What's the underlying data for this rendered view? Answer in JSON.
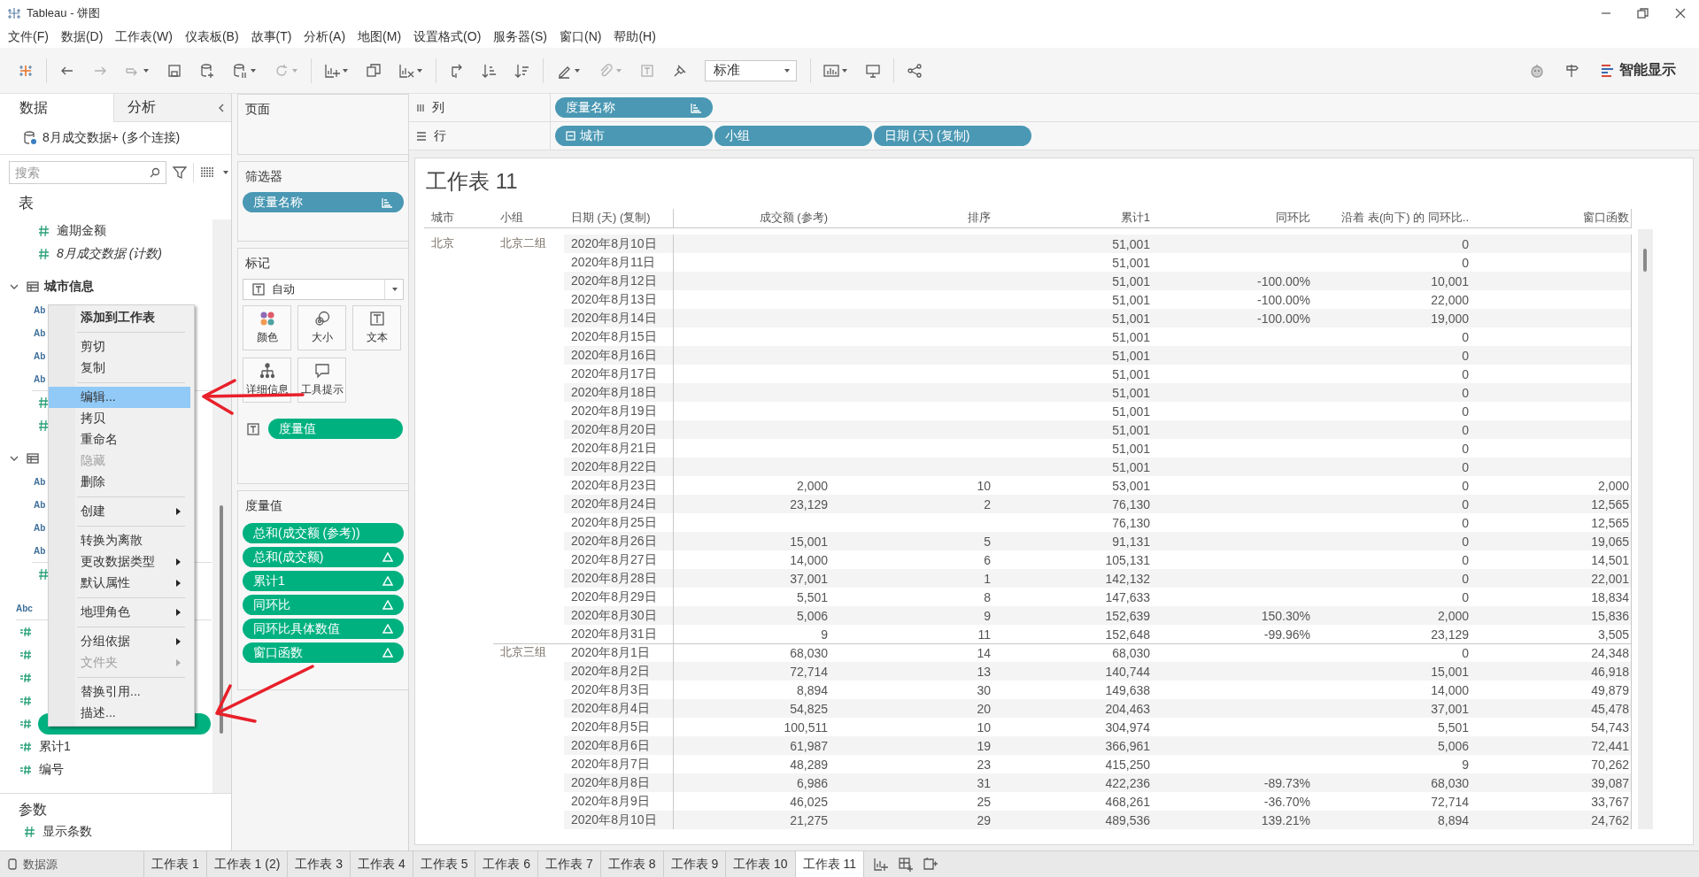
{
  "window": {
    "title": "Tableau - 饼图"
  },
  "menu_bar": [
    "文件(F)",
    "数据(D)",
    "工作表(W)",
    "仪表板(B)",
    "故事(T)",
    "分析(A)",
    "地图(M)",
    "设置格式(O)",
    "服务器(S)",
    "窗口(N)",
    "帮助(H)"
  ],
  "toolbar": {
    "fit_dropdown": "标准",
    "show_me": "智能显示"
  },
  "data_pane": {
    "tabs": [
      {
        "label": "数据",
        "selected": true
      },
      {
        "label": "分析",
        "selected": false
      }
    ],
    "data_source": "8月成交数据+ (多个连接)",
    "search": {
      "placeholder": "搜索"
    },
    "section_title": "表",
    "tables": [
      {
        "items": [
          {
            "kind": "measure",
            "name": "逾期金额",
            "selected": false
          },
          {
            "kind": "measure",
            "name": "8月成交数据 (计数)",
            "italic": true,
            "selected": false
          }
        ]
      },
      {
        "name": "城市信息",
        "expanded": true,
        "items": [
          {
            "kind": "dimension",
            "icon_text": "Ab",
            "selected": false
          },
          {
            "kind": "dimension",
            "icon_text": "Ab",
            "selected": false
          },
          {
            "kind": "dimension",
            "icon_text": "Ab",
            "selected": false
          },
          {
            "kind": "dimension",
            "icon_text": "Ab",
            "selected": false
          },
          {
            "kind": "divider"
          },
          {
            "kind": "measure",
            "selected": false
          },
          {
            "kind": "measure",
            "selected": false
          }
        ]
      },
      {
        "expanded": true,
        "items": [
          {
            "kind": "dimension",
            "icon_text": "Ab",
            "selected": false
          },
          {
            "kind": "dimension",
            "icon_text": "Ab",
            "selected": false
          },
          {
            "kind": "dimension",
            "icon_text": "Ab",
            "selected": false
          },
          {
            "kind": "dimension",
            "icon_text": "Ab",
            "selected": false
          },
          {
            "kind": "divider"
          },
          {
            "kind": "measure",
            "selected": false
          }
        ]
      }
    ],
    "loose_fields": [
      {
        "kind": "dimension",
        "icon_text": "Abc",
        "selected": false
      },
      {
        "kind": "divider"
      },
      {
        "kind": "calc",
        "selected": false
      },
      {
        "kind": "calc",
        "selected": false
      },
      {
        "kind": "calc",
        "selected": false
      },
      {
        "kind": "calc",
        "selected": false
      },
      {
        "kind": "calc",
        "selected": true
      },
      {
        "kind": "calc",
        "name": "累计1",
        "selected": false
      },
      {
        "kind": "calc",
        "name": "编号",
        "selected": false
      }
    ],
    "parameters_title": "参数",
    "parameters": [
      {
        "kind": "measure",
        "name": "显示条数"
      }
    ]
  },
  "context_menu": [
    {
      "kind": "item",
      "label": "添加到工作表",
      "bold": true,
      "selected": false
    },
    {
      "kind": "separator"
    },
    {
      "kind": "item",
      "label": "剪切",
      "selected": false
    },
    {
      "kind": "item",
      "label": "复制",
      "selected": false
    },
    {
      "kind": "separator"
    },
    {
      "kind": "item",
      "label": "编辑...",
      "selected": true
    },
    {
      "kind": "item",
      "label": "拷贝",
      "selected": false
    },
    {
      "kind": "item",
      "label": "重命名",
      "selected": false
    },
    {
      "kind": "item",
      "label": "隐藏",
      "disabled": true,
      "selected": false
    },
    {
      "kind": "item",
      "label": "删除",
      "selected": false
    },
    {
      "kind": "separator"
    },
    {
      "kind": "item",
      "label": "创建",
      "submenu": true,
      "selected": false
    },
    {
      "kind": "separator"
    },
    {
      "kind": "item",
      "label": "转换为离散",
      "selected": false
    },
    {
      "kind": "item",
      "label": "更改数据类型",
      "submenu": true,
      "selected": false
    },
    {
      "kind": "item",
      "label": "默认属性",
      "submenu": true,
      "selected": false
    },
    {
      "kind": "separator"
    },
    {
      "kind": "item",
      "label": "地理角色",
      "submenu": true,
      "selected": false
    },
    {
      "kind": "separator"
    },
    {
      "kind": "item",
      "label": "分组依据",
      "submenu": true,
      "selected": false
    },
    {
      "kind": "item",
      "label": "文件夹",
      "submenu": true,
      "disabled": true,
      "selected": false
    },
    {
      "kind": "separator"
    },
    {
      "kind": "item",
      "label": "替换引用...",
      "selected": false
    },
    {
      "kind": "item",
      "label": "描述...",
      "selected": false
    }
  ],
  "cards": {
    "pages": {
      "title": "页面"
    },
    "filters": {
      "title": "筛选器",
      "pills": [
        {
          "label": "度量名称",
          "kind": "dimension",
          "sorted": true
        }
      ]
    },
    "marks": {
      "title": "标记",
      "mark_type": "自动",
      "buttons": [
        {
          "label": "颜色",
          "kind": "color"
        },
        {
          "label": "大小",
          "kind": "size"
        },
        {
          "label": "文本",
          "kind": "text"
        },
        {
          "label": "详细信息",
          "kind": "detail"
        },
        {
          "label": "工具提示",
          "kind": "tooltip"
        }
      ],
      "encodings": [
        {
          "kind": "text",
          "pill": {
            "label": "度量值",
            "kind": "measure"
          }
        }
      ]
    },
    "measure_values": {
      "title": "度量值",
      "pills": [
        {
          "label": "总和(成交额 (参考))",
          "kind": "measure",
          "table_calc": false
        },
        {
          "label": "总和(成交额)",
          "kind": "measure",
          "table_calc": true
        },
        {
          "label": "累计1",
          "kind": "measure",
          "table_calc": true
        },
        {
          "label": "同环比",
          "kind": "measure",
          "table_calc": true
        },
        {
          "label": "同环比具体数值",
          "kind": "measure",
          "table_calc": true
        },
        {
          "label": "窗口函数",
          "kind": "measure",
          "table_calc": true
        }
      ]
    }
  },
  "shelves": {
    "columns": {
      "label": "列",
      "pills": [
        {
          "label": "度量名称",
          "kind": "dimension",
          "sorted": true
        }
      ]
    },
    "rows": {
      "label": "行",
      "pills": [
        {
          "label": "城市",
          "kind": "dimension",
          "expandable": true
        },
        {
          "label": "小组",
          "kind": "dimension"
        },
        {
          "label": "日期 (天) (复制)",
          "kind": "dimension"
        }
      ]
    }
  },
  "view": {
    "title": "工作表 11",
    "columns": [
      "城市",
      "小组",
      "日期 (天) (复制)",
      "成交额 (参考)",
      "排序",
      "累计1",
      "同环比",
      "沿着 表(向下) 的 同环比..",
      "窗口函数"
    ],
    "groups": [
      {
        "city": "北京",
        "name": "北京二组",
        "rows": [
          {
            "date": "2020年8月10日",
            "cum": "51,001",
            "along": "0"
          },
          {
            "date": "2020年8月11日",
            "cum": "51,001",
            "along": "0"
          },
          {
            "date": "2020年8月12日",
            "cum": "51,001",
            "yoy": "-100.00%",
            "along": "10,001"
          },
          {
            "date": "2020年8月13日",
            "cum": "51,001",
            "yoy": "-100.00%",
            "along": "22,000"
          },
          {
            "date": "2020年8月14日",
            "cum": "51,001",
            "yoy": "-100.00%",
            "along": "19,000"
          },
          {
            "date": "2020年8月15日",
            "cum": "51,001",
            "along": "0"
          },
          {
            "date": "2020年8月16日",
            "cum": "51,001",
            "along": "0"
          },
          {
            "date": "2020年8月17日",
            "cum": "51,001",
            "along": "0"
          },
          {
            "date": "2020年8月18日",
            "cum": "51,001",
            "along": "0"
          },
          {
            "date": "2020年8月19日",
            "cum": "51,001",
            "along": "0"
          },
          {
            "date": "2020年8月20日",
            "cum": "51,001",
            "along": "0"
          },
          {
            "date": "2020年8月21日",
            "cum": "51,001",
            "along": "0"
          },
          {
            "date": "2020年8月22日",
            "cum": "51,001",
            "along": "0"
          },
          {
            "date": "2020年8月23日",
            "amount": "2,000",
            "rank": "10",
            "cum": "53,001",
            "along": "0",
            "window": "2,000"
          },
          {
            "date": "2020年8月24日",
            "amount": "23,129",
            "rank": "2",
            "cum": "76,130",
            "along": "0",
            "window": "12,565"
          },
          {
            "date": "2020年8月25日",
            "cum": "76,130",
            "along": "0",
            "window": "12,565"
          },
          {
            "date": "2020年8月26日",
            "amount": "15,001",
            "rank": "5",
            "cum": "91,131",
            "along": "0",
            "window": "19,065"
          },
          {
            "date": "2020年8月27日",
            "amount": "14,000",
            "rank": "6",
            "cum": "105,131",
            "along": "0",
            "window": "14,501"
          },
          {
            "date": "2020年8月28日",
            "amount": "37,001",
            "rank": "1",
            "cum": "142,132",
            "along": "0",
            "window": "22,001"
          },
          {
            "date": "2020年8月29日",
            "amount": "5,501",
            "rank": "8",
            "cum": "147,633",
            "along": "0",
            "window": "18,834"
          },
          {
            "date": "2020年8月30日",
            "amount": "5,006",
            "rank": "9",
            "cum": "152,639",
            "yoy": "150.30%",
            "along": "2,000",
            "window": "15,836"
          },
          {
            "date": "2020年8月31日",
            "amount": "9",
            "rank": "11",
            "cum": "152,648",
            "yoy": "-99.96%",
            "along": "23,129",
            "window": "3,505"
          }
        ]
      },
      {
        "name": "北京三组",
        "rows": [
          {
            "date": "2020年8月1日",
            "amount": "68,030",
            "rank": "14",
            "cum": "68,030",
            "along": "0",
            "window": "24,348"
          },
          {
            "date": "2020年8月2日",
            "amount": "72,714",
            "rank": "13",
            "cum": "140,744",
            "along": "15,001",
            "window": "46,918"
          },
          {
            "date": "2020年8月3日",
            "amount": "8,894",
            "rank": "30",
            "cum": "149,638",
            "along": "14,000",
            "window": "49,879"
          },
          {
            "date": "2020年8月4日",
            "amount": "54,825",
            "rank": "20",
            "cum": "204,463",
            "along": "37,001",
            "window": "45,478"
          },
          {
            "date": "2020年8月5日",
            "amount": "100,511",
            "rank": "10",
            "cum": "304,974",
            "along": "5,501",
            "window": "54,743"
          },
          {
            "date": "2020年8月6日",
            "amount": "61,987",
            "rank": "19",
            "cum": "366,961",
            "along": "5,006",
            "window": "72,441"
          },
          {
            "date": "2020年8月7日",
            "amount": "48,289",
            "rank": "23",
            "cum": "415,250",
            "along": "9",
            "window": "70,262"
          },
          {
            "date": "2020年8月8日",
            "amount": "6,986",
            "rank": "31",
            "cum": "422,236",
            "yoy": "-89.73%",
            "along": "68,030",
            "window": "39,087"
          },
          {
            "date": "2020年8月9日",
            "amount": "46,025",
            "rank": "25",
            "cum": "468,261",
            "yoy": "-36.70%",
            "along": "72,714",
            "window": "33,767"
          },
          {
            "date": "2020年8月10日",
            "amount": "21,275",
            "rank": "29",
            "cum": "489,536",
            "yoy": "139.21%",
            "along": "8,894",
            "window": "24,762"
          }
        ]
      }
    ]
  },
  "sheet_tabs": {
    "data_source": "数据源",
    "sheets": [
      {
        "label": "工作表 1",
        "selected": false
      },
      {
        "label": "工作表 1 (2)",
        "selected": false
      },
      {
        "label": "工作表 3",
        "selected": false
      },
      {
        "label": "工作表 4",
        "selected": false
      },
      {
        "label": "工作表 5",
        "selected": false
      },
      {
        "label": "工作表 6",
        "selected": false
      },
      {
        "label": "工作表 7",
        "selected": false
      },
      {
        "label": "工作表 8",
        "selected": false
      },
      {
        "label": "工作表 9",
        "selected": false
      },
      {
        "label": "工作表 10",
        "selected": false
      },
      {
        "label": "工作表 11",
        "selected": true
      }
    ]
  }
}
